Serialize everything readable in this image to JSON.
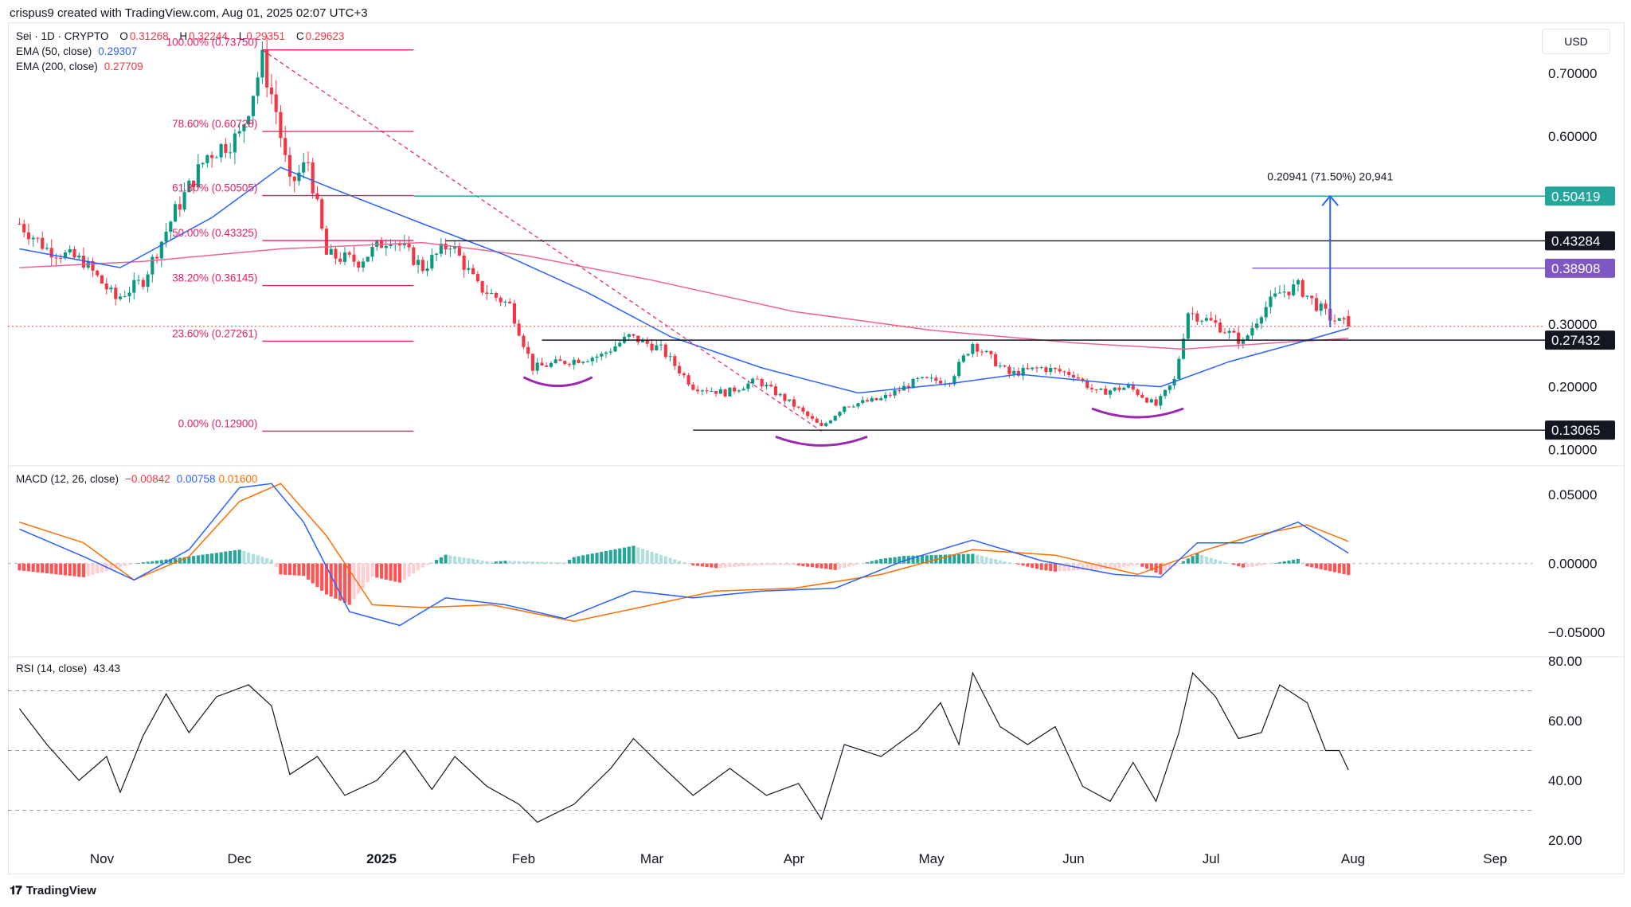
{
  "header": {
    "attribution": "crispus9 created with TradingView.com, Aug 01, 2025 02:07 UTC+3",
    "currency": "USD"
  },
  "legend": {
    "symbol": "Sei · 1D · CRYPTO",
    "open_label": "O",
    "open": "0.31268",
    "high_label": "H",
    "high": "0.32244",
    "low_label": "L",
    "low": "0.29351",
    "close_label": "C",
    "close": "0.29623",
    "ema50_label": "EMA (50, close)",
    "ema50_value": "0.29307",
    "ema200_label": "EMA (200, close)",
    "ema200_value": "0.27709",
    "macd_label": "MACD (12, 26, close)",
    "macd_hist": "−0.00842",
    "macd_line": "0.00758",
    "macd_signal": "0.01600",
    "rsi_label": "RSI (14, close)",
    "rsi_value": "43.43"
  },
  "colors": {
    "up": "#089981",
    "down": "#f23645",
    "ema50": "#2962ff",
    "ema200": "#f06292",
    "fib": "#e91e63",
    "macd_line": "#2962ff",
    "macd_signal": "#ff6d00",
    "teal_level": "#26a69a",
    "purple_level": "#7e57c2",
    "arc": "#9c27b0",
    "rsi": "#131722"
  },
  "chart_data": [
    {
      "type": "candlestick",
      "title": "Sei · 1D · CRYPTO",
      "ylim": [
        0.08,
        0.76
      ],
      "yticks": [
        "0.70000",
        "0.60000",
        "0.30000",
        "0.20000",
        "0.10000"
      ],
      "x_tick_labels": [
        "Nov",
        "Dec",
        "2025",
        "Feb",
        "Mar",
        "Apr",
        "May",
        "Jun",
        "Jul",
        "Aug",
        "Sep"
      ],
      "x_ticks_date": [
        "2024-11-01",
        "2024-12-01",
        "2025-01-01",
        "2025-02-01",
        "2025-03-01",
        "2025-04-01",
        "2025-05-01",
        "2025-06-01",
        "2025-07-01",
        "2025-08-01",
        "2025-09-01"
      ],
      "close_anchors": [
        [
          "2024-10-14",
          0.46
        ],
        [
          "2024-10-20",
          0.42
        ],
        [
          "2024-10-28",
          0.4
        ],
        [
          "2024-11-04",
          0.34
        ],
        [
          "2024-11-10",
          0.37
        ],
        [
          "2024-11-17",
          0.48
        ],
        [
          "2024-11-24",
          0.57
        ],
        [
          "2024-12-01",
          0.6
        ],
        [
          "2024-12-06",
          0.72
        ],
        [
          "2024-12-09",
          0.64
        ],
        [
          "2024-12-12",
          0.52
        ],
        [
          "2024-12-16",
          0.56
        ],
        [
          "2024-12-20",
          0.41
        ],
        [
          "2024-12-27",
          0.4
        ],
        [
          "2025-01-03",
          0.44
        ],
        [
          "2025-01-10",
          0.39
        ],
        [
          "2025-01-16",
          0.43
        ],
        [
          "2025-01-22",
          0.36
        ],
        [
          "2025-01-29",
          0.33
        ],
        [
          "2025-02-03",
          0.23
        ],
        [
          "2025-02-10",
          0.24
        ],
        [
          "2025-02-18",
          0.25
        ],
        [
          "2025-02-24",
          0.28
        ],
        [
          "2025-03-03",
          0.26
        ],
        [
          "2025-03-10",
          0.2
        ],
        [
          "2025-03-17",
          0.19
        ],
        [
          "2025-03-24",
          0.21
        ],
        [
          "2025-04-01",
          0.17
        ],
        [
          "2025-04-07",
          0.135
        ],
        [
          "2025-04-12",
          0.17
        ],
        [
          "2025-04-20",
          0.18
        ],
        [
          "2025-04-28",
          0.21
        ],
        [
          "2025-05-05",
          0.21
        ],
        [
          "2025-05-10",
          0.27
        ],
        [
          "2025-05-18",
          0.22
        ],
        [
          "2025-05-25",
          0.23
        ],
        [
          "2025-06-01",
          0.22
        ],
        [
          "2025-06-06",
          0.19
        ],
        [
          "2025-06-13",
          0.2
        ],
        [
          "2025-06-19",
          0.17
        ],
        [
          "2025-06-23",
          0.21
        ],
        [
          "2025-06-26",
          0.32
        ],
        [
          "2025-07-02",
          0.3
        ],
        [
          "2025-07-08",
          0.27
        ],
        [
          "2025-07-12",
          0.32
        ],
        [
          "2025-07-16",
          0.35
        ],
        [
          "2025-07-20",
          0.36
        ],
        [
          "2025-07-24",
          0.33
        ],
        [
          "2025-07-27",
          0.31
        ],
        [
          "2025-07-31",
          0.29623
        ]
      ],
      "fibonacci": [
        {
          "label": "100.00% (0.73750)",
          "value": 0.7375
        },
        {
          "label": "78.60% (0.60728)",
          "value": 0.60728
        },
        {
          "label": "61.80% (0.50505)",
          "value": 0.50505
        },
        {
          "label": "50.00% (0.43325)",
          "value": 0.43325
        },
        {
          "label": "38.20% (0.36145)",
          "value": 0.36145
        },
        {
          "label": "23.60% (0.27261)",
          "value": 0.27261
        },
        {
          "label": "0.00% (0.12900)",
          "value": 0.129
        }
      ],
      "fib_start_date": "2024-12-06",
      "fib_end_date": "2025-04-07",
      "price_levels": [
        {
          "label": "0.50419",
          "value": 0.50419,
          "color": "#26a69a",
          "from": "2025-01-08"
        },
        {
          "label": "0.43284",
          "value": 0.43284,
          "color": "#131722",
          "from": "2025-01-15"
        },
        {
          "label": "0.38908",
          "value": 0.38908,
          "color": "#7e57c2",
          "from": "2025-07-10"
        },
        {
          "label": "0.27432",
          "value": 0.27432,
          "color": "#131722",
          "from": "2025-02-05"
        },
        {
          "label": "0.13065",
          "value": 0.13065,
          "color": "#131722",
          "from": "2025-03-10"
        }
      ],
      "measure": {
        "label": "0.20941 (71.50%) 20,941",
        "from_date": "2025-07-27",
        "from": 0.29478,
        "to": 0.50419
      },
      "ema50": [
        [
          "2024-10-14",
          0.42
        ],
        [
          "2024-11-05",
          0.39
        ],
        [
          "2024-11-25",
          0.47
        ],
        [
          "2024-12-10",
          0.55
        ],
        [
          "2024-12-20",
          0.52
        ],
        [
          "2025-01-10",
          0.46
        ],
        [
          "2025-01-28",
          0.41
        ],
        [
          "2025-02-15",
          0.35
        ],
        [
          "2025-03-05",
          0.28
        ],
        [
          "2025-03-25",
          0.23
        ],
        [
          "2025-04-15",
          0.19
        ],
        [
          "2025-05-05",
          0.205
        ],
        [
          "2025-05-20",
          0.22
        ],
        [
          "2025-06-10",
          0.205
        ],
        [
          "2025-06-20",
          0.2
        ],
        [
          "2025-07-05",
          0.24
        ],
        [
          "2025-07-20",
          0.27
        ],
        [
          "2025-07-31",
          0.29307
        ]
      ],
      "ema200": [
        [
          "2024-10-14",
          0.39
        ],
        [
          "2024-11-10",
          0.4
        ],
        [
          "2024-12-10",
          0.42
        ],
        [
          "2025-01-10",
          0.43
        ],
        [
          "2025-02-01",
          0.41
        ],
        [
          "2025-03-01",
          0.37
        ],
        [
          "2025-04-01",
          0.32
        ],
        [
          "2025-05-01",
          0.29
        ],
        [
          "2025-06-01",
          0.27
        ],
        [
          "2025-06-25",
          0.26
        ],
        [
          "2025-07-15",
          0.27
        ],
        [
          "2025-07-31",
          0.27709
        ]
      ]
    },
    {
      "type": "line",
      "title": "MACD (12, 26, close)",
      "ylim": [
        -0.065,
        0.068
      ],
      "yticks": [
        "0.05000",
        "0.00000",
        "−0.05000"
      ],
      "macd": [
        [
          "2024-10-14",
          0.025
        ],
        [
          "2024-10-28",
          0.005
        ],
        [
          "2024-11-08",
          -0.012
        ],
        [
          "2024-11-20",
          0.01
        ],
        [
          "2024-12-01",
          0.055
        ],
        [
          "2024-12-08",
          0.058
        ],
        [
          "2024-12-15",
          0.03
        ],
        [
          "2024-12-25",
          -0.035
        ],
        [
          "2025-01-05",
          -0.045
        ],
        [
          "2025-01-15",
          -0.025
        ],
        [
          "2025-01-28",
          -0.03
        ],
        [
          "2025-02-10",
          -0.04
        ],
        [
          "2025-02-25",
          -0.02
        ],
        [
          "2025-03-10",
          -0.025
        ],
        [
          "2025-03-25",
          -0.02
        ],
        [
          "2025-04-10",
          -0.018
        ],
        [
          "2025-04-25",
          0.002
        ],
        [
          "2025-05-10",
          0.017
        ],
        [
          "2025-05-25",
          0.002
        ],
        [
          "2025-06-10",
          -0.008
        ],
        [
          "2025-06-20",
          -0.01
        ],
        [
          "2025-06-28",
          0.015
        ],
        [
          "2025-07-08",
          0.015
        ],
        [
          "2025-07-20",
          0.03
        ],
        [
          "2025-07-31",
          0.00758
        ]
      ],
      "signal": [
        [
          "2024-10-14",
          0.03
        ],
        [
          "2024-10-28",
          0.015
        ],
        [
          "2024-11-08",
          -0.012
        ],
        [
          "2024-11-20",
          0.005
        ],
        [
          "2024-12-01",
          0.045
        ],
        [
          "2024-12-10",
          0.058
        ],
        [
          "2024-12-20",
          0.02
        ],
        [
          "2024-12-30",
          -0.03
        ],
        [
          "2025-01-10",
          -0.032
        ],
        [
          "2025-01-25",
          -0.03
        ],
        [
          "2025-02-12",
          -0.042
        ],
        [
          "2025-03-01",
          -0.03
        ],
        [
          "2025-03-15",
          -0.02
        ],
        [
          "2025-04-01",
          -0.018
        ],
        [
          "2025-04-20",
          -0.008
        ],
        [
          "2025-05-10",
          0.01
        ],
        [
          "2025-05-28",
          0.006
        ],
        [
          "2025-06-15",
          -0.008
        ],
        [
          "2025-06-30",
          0.01
        ],
        [
          "2025-07-10",
          0.02
        ],
        [
          "2025-07-22",
          0.028
        ],
        [
          "2025-07-31",
          0.016
        ]
      ]
    },
    {
      "type": "line",
      "title": "RSI (14, close)",
      "ylim": [
        20,
        80
      ],
      "yticks": [
        "80.00",
        "60.00",
        "40.00",
        "20.00"
      ],
      "bands": [
        70,
        50,
        30
      ],
      "rsi": [
        [
          "2024-10-14",
          64
        ],
        [
          "2024-10-20",
          52
        ],
        [
          "2024-10-27",
          40
        ],
        [
          "2024-11-02",
          48
        ],
        [
          "2024-11-05",
          36
        ],
        [
          "2024-11-10",
          55
        ],
        [
          "2024-11-15",
          69
        ],
        [
          "2024-11-20",
          56
        ],
        [
          "2024-11-26",
          68
        ],
        [
          "2024-12-03",
          72
        ],
        [
          "2024-12-08",
          65
        ],
        [
          "2024-12-12",
          42
        ],
        [
          "2024-12-18",
          48
        ],
        [
          "2024-12-24",
          35
        ],
        [
          "2024-12-31",
          40
        ],
        [
          "2025-01-06",
          50
        ],
        [
          "2025-01-12",
          37
        ],
        [
          "2025-01-17",
          48
        ],
        [
          "2025-01-24",
          38
        ],
        [
          "2025-01-31",
          32
        ],
        [
          "2025-02-04",
          26
        ],
        [
          "2025-02-12",
          32
        ],
        [
          "2025-02-20",
          44
        ],
        [
          "2025-02-25",
          54
        ],
        [
          "2025-03-03",
          45
        ],
        [
          "2025-03-10",
          35
        ],
        [
          "2025-03-18",
          44
        ],
        [
          "2025-03-26",
          35
        ],
        [
          "2025-04-02",
          39
        ],
        [
          "2025-04-07",
          27
        ],
        [
          "2025-04-12",
          52
        ],
        [
          "2025-04-20",
          48
        ],
        [
          "2025-04-28",
          57
        ],
        [
          "2025-05-03",
          66
        ],
        [
          "2025-05-07",
          52
        ],
        [
          "2025-05-10",
          76
        ],
        [
          "2025-05-16",
          58
        ],
        [
          "2025-05-22",
          52
        ],
        [
          "2025-05-28",
          58
        ],
        [
          "2025-06-03",
          38
        ],
        [
          "2025-06-09",
          33
        ],
        [
          "2025-06-14",
          46
        ],
        [
          "2025-06-19",
          33
        ],
        [
          "2025-06-24",
          56
        ],
        [
          "2025-06-27",
          76
        ],
        [
          "2025-07-02",
          68
        ],
        [
          "2025-07-07",
          54
        ],
        [
          "2025-07-12",
          56
        ],
        [
          "2025-07-16",
          72
        ],
        [
          "2025-07-22",
          66
        ],
        [
          "2025-07-26",
          50
        ],
        [
          "2025-07-29",
          50
        ],
        [
          "2025-07-31",
          43.43
        ]
      ]
    }
  ]
}
